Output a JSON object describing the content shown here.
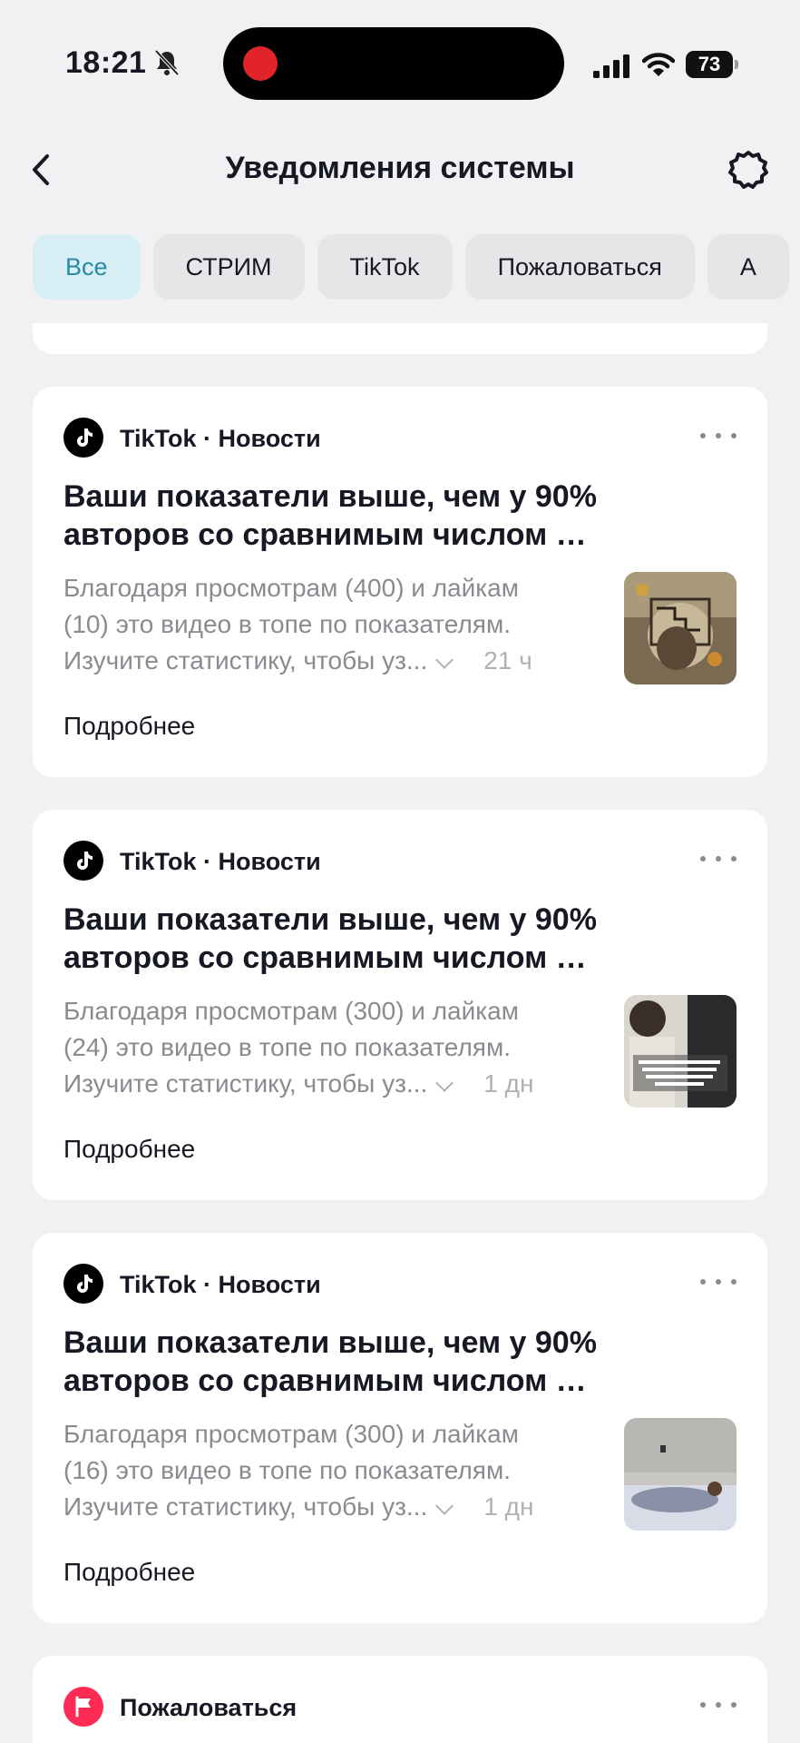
{
  "status_bar": {
    "time": "18:21",
    "battery": "73"
  },
  "header": {
    "title": "Уведомления системы"
  },
  "tabs": [
    {
      "label": "Все",
      "active": true
    },
    {
      "label": "СТРИМ",
      "active": false
    },
    {
      "label": "TikTok",
      "active": false
    },
    {
      "label": "Пожаловаться",
      "active": false
    },
    {
      "label": "А",
      "active": false
    }
  ],
  "cards": [
    {
      "source": "TikTok · Новости",
      "title_line1": "Ваши показатели выше, чем у 90%",
      "title_line2": "авторов со сравнимым числом …",
      "body_line1": "Благодаря просмотрам (400) и лайкам",
      "body_line2": "(10) это видео в топе по показателям.",
      "body_line3": "Изучите статистику, чтобы уз...",
      "age": "21 ч",
      "more": "Подробнее"
    },
    {
      "source": "TikTok · Новости",
      "title_line1": "Ваши показатели выше, чем у 90%",
      "title_line2": "авторов со сравнимым числом …",
      "body_line1": "Благодаря просмотрам (300) и лайкам",
      "body_line2": "(24) это видео в топе по показателям.",
      "body_line3": "Изучите статистику, чтобы уз...",
      "age": "1 дн",
      "more": "Подробнее"
    },
    {
      "source": "TikTok · Новости",
      "title_line1": "Ваши показатели выше, чем у 90%",
      "title_line2": "авторов со сравнимым числом …",
      "body_line1": "Благодаря просмотрам (300) и лайкам",
      "body_line2": "(16) это видео в топе по показателям.",
      "body_line3": "Изучите статистику, чтобы уз...",
      "age": "1 дн",
      "more": "Подробнее"
    }
  ],
  "report_card": {
    "source": "Пожаловаться"
  },
  "colors": {
    "active_tab_text": "#2a8aa6",
    "active_tab_bg": "#d7eef4",
    "report_icon": "#fe2c55"
  }
}
